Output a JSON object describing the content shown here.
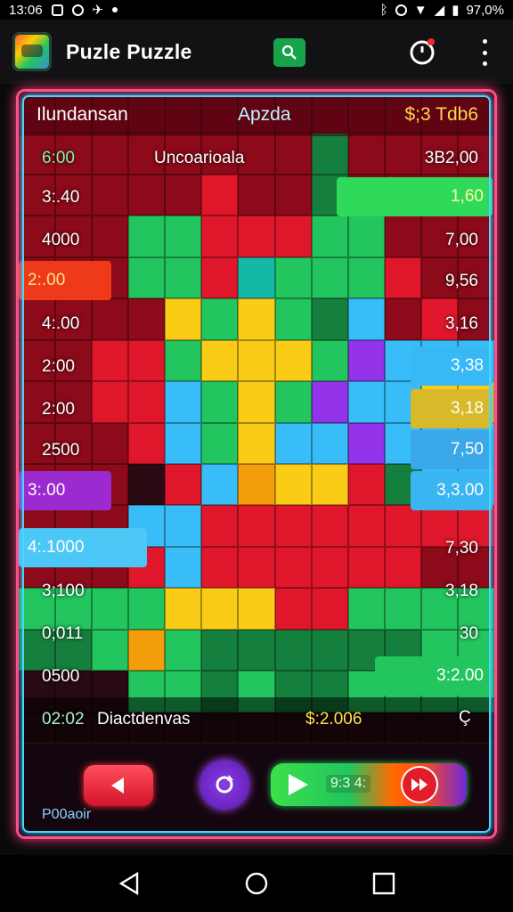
{
  "status_bar": {
    "time": "13:06",
    "battery": "97,0%"
  },
  "app_bar": {
    "title": "Puzle Puzzle"
  },
  "board": {
    "header": {
      "left": "Ilundansan",
      "center": "Apzda",
      "right": "$;3 Tdb6"
    },
    "subheader": {
      "left": "6:00",
      "center": "Uncoarioala",
      "right": "3B2,00"
    },
    "rows": [
      {
        "left": "3:.40",
        "right": "1,60"
      },
      {
        "left": "4000",
        "right": "7,00"
      },
      {
        "left": "2:.00",
        "right": "9,56"
      },
      {
        "left": "4:.00",
        "right": "3,16"
      },
      {
        "left": "2:00",
        "right": "3,38"
      },
      {
        "left": "2:00",
        "right": "3,18"
      },
      {
        "left": "2500",
        "right": "7,50"
      },
      {
        "left": "3:.00",
        "right": "3,3.00"
      },
      {
        "left": "4:.1000",
        "right": "7,30"
      },
      {
        "left": "3;100",
        "right": "3,18"
      },
      {
        "left": "0;011",
        "right": "30"
      },
      {
        "left": "0500",
        "right": "3:2.00"
      }
    ],
    "footer": {
      "left": "02:02",
      "center": "Diactdenvas",
      "right": "$:2.006",
      "icon": "Ç"
    },
    "controls": {
      "play_label": "9:3 4:"
    },
    "bottom_label": "P00aoir"
  },
  "colors": {
    "red": "#e0162b",
    "dark_red": "#8c0a1a",
    "green": "#22c55e",
    "dark_green": "#15803d",
    "yellow": "#facc15",
    "orange": "#f59e0b",
    "blue": "#38bdf8",
    "purple": "#9333ea",
    "teal": "#14b8a6"
  }
}
